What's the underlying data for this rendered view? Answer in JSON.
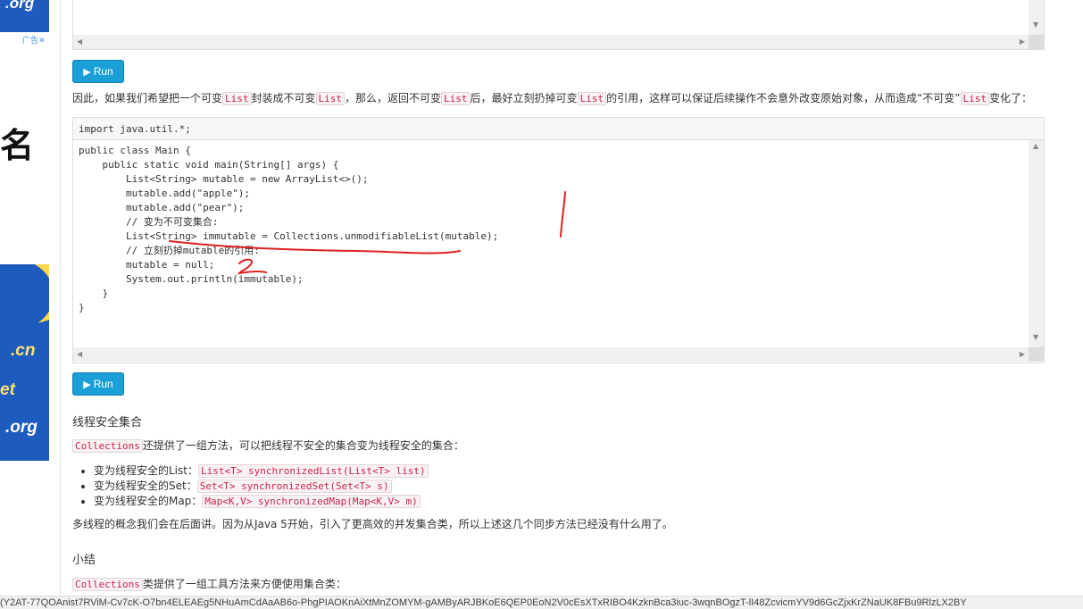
{
  "ad": {
    "top_domain": ".org",
    "close_label": "广告✕",
    "big_char": "名",
    "domain_cn": ".cn",
    "domain_net": "et",
    "domain_org": ".org"
  },
  "editor_top": {
    "code": ""
  },
  "run_label": "Run",
  "paragraph1": {
    "p1": "因此，如果我们希望把一个可变",
    "c1": "List",
    "p2": "封装成不可变",
    "c2": "List",
    "p3": "，那么，返回不可变",
    "c3": "List",
    "p4": "后，最好立刻扔掉可变",
    "c4": "List",
    "p5": "的引用，这样可以保证后续操作不会意外改变原始对象，从而造成“不可变”",
    "c5": "List",
    "p6": "变化了："
  },
  "editor_main": {
    "header_line": "import java.util.*;",
    "code": "public class Main {\n    public static void main(String[] args) {\n        List<String> mutable = new ArrayList<>();\n        mutable.add(\"apple\");\n        mutable.add(\"pear\");\n        // 变为不可变集合:\n        List<String> immutable = Collections.unmodifiableList(mutable);\n        // 立刻扔掉mutable的引用:\n        mutable = null;\n        System.out.println(immutable);\n    }\n}"
  },
  "section_thread_safe": {
    "title": "线程安全集合",
    "intro_code": "Collections",
    "intro_text": "还提供了一组方法，可以把线程不安全的集合变为线程安全的集合：",
    "items": [
      {
        "label": "变为线程安全的List：",
        "code": "List<T> synchronizedList(List<T> list)"
      },
      {
        "label": "变为线程安全的Set：",
        "code": "Set<T> synchronizedSet(Set<T> s)"
      },
      {
        "label": "变为线程安全的Map：",
        "code": "Map<K,V> synchronizedMap(Map<K,V> m)"
      }
    ],
    "note": "多线程的概念我们会在后面讲。因为从Java 5开始，引入了更高效的并发集合类，所以上述这几个同步方法已经没有什么用了。"
  },
  "section_summary": {
    "title": "小结",
    "intro_code": "Collections",
    "intro_text": "类提供了一组工具方法来方便使用集合类："
  },
  "status_bar": "(Y2AT-77QOAnist7RViM-Cv7cK-O7bn4ELEAEg5NHuAmCdAaAB6o-PhgPIAOKnAiXtMnZOMYM-gAMByARJBKoE6QEP0EoN2V0cEsXTxRIBO4KzknBca3iuc-3wqnBOgzT-lI48ZcvicmYV9d6GcZjxKrZNaUK8FBu9RlzLX2BY"
}
